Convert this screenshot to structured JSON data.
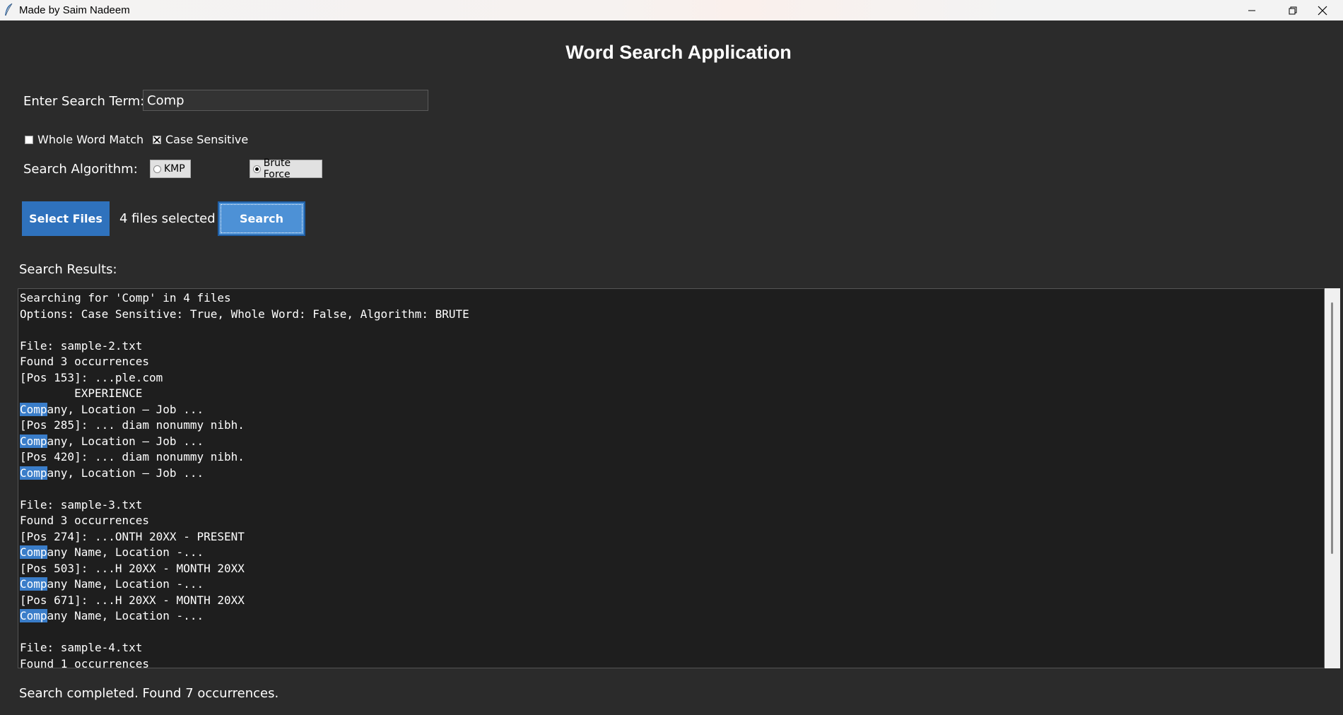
{
  "window": {
    "title": "Made by Saim Nadeem",
    "minimize_icon": "minimize-icon",
    "maximize_icon": "restore-icon",
    "close_icon": "close-icon"
  },
  "app": {
    "title": "Word Search Application"
  },
  "search": {
    "label": "Enter Search Term:",
    "value": "Comp"
  },
  "options": {
    "whole_word_label": "Whole Word Match",
    "whole_word_checked": false,
    "case_sensitive_label": "Case Sensitive",
    "case_sensitive_checked": true
  },
  "algorithm": {
    "label": "Search Algorithm:",
    "options": [
      {
        "label": "KMP",
        "selected": false
      },
      {
        "label": "Brute Force",
        "selected": true
      }
    ]
  },
  "actions": {
    "select_files_label": "Select Files",
    "files_selected_text": "4 files selected",
    "search_label": "Search"
  },
  "results": {
    "label": "Search Results:",
    "highlight_term": "Comp",
    "lines": [
      "Searching for 'Comp' in 4 files",
      "Options: Case Sensitive: True, Whole Word: False, Algorithm: BRUTE",
      "",
      "File: sample-2.txt",
      "Found 3 occurrences",
      "[Pos 153]: ...ple.com",
      "        EXPERIENCE",
      "Company, Location — Job ...",
      "[Pos 285]: ... diam nonummy nibh.",
      "Company, Location — Job ...",
      "[Pos 420]: ... diam nonummy nibh.",
      "Company, Location — Job ...",
      "",
      "File: sample-3.txt",
      "Found 3 occurrences",
      "[Pos 274]: ...ONTH 20XX - PRESENT",
      "Company Name, Location -...",
      "[Pos 503]: ...H 20XX - MONTH 20XX",
      "Company Name, Location -...",
      "[Pos 671]: ...H 20XX - MONTH 20XX",
      "Company Name, Location -...",
      "",
      "File: sample-4.txt",
      "Found 1 occurrences"
    ]
  },
  "status": {
    "text": "Search completed. Found 7 occurrences."
  },
  "colors": {
    "background": "#2b2b2b",
    "results_background": "#1e1e1e",
    "primary_button": "#2f72bd",
    "search_button": "#4d91d6",
    "highlight": "#3a7dc9"
  }
}
